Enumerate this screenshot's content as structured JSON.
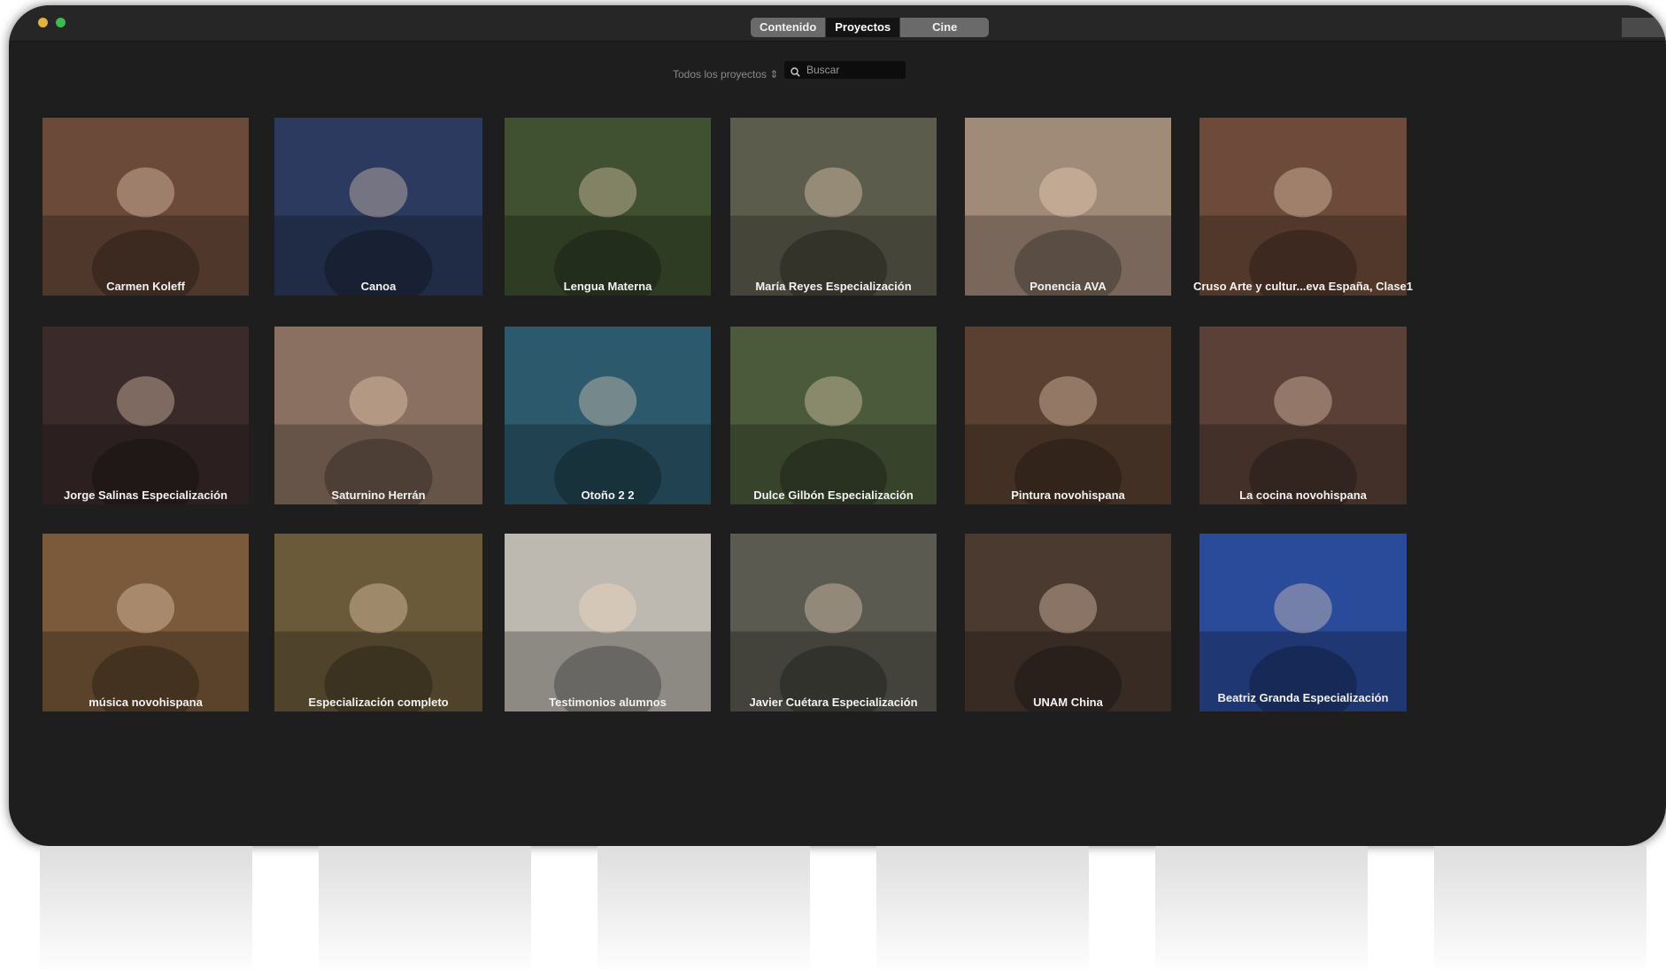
{
  "tabs": [
    {
      "label": "Contenido",
      "active": false
    },
    {
      "label": "Proyectos",
      "active": true
    },
    {
      "label": "Cine",
      "active": false
    }
  ],
  "toolbar": {
    "project_filter": "Todos los proyectos",
    "search_placeholder": "Buscar"
  },
  "projects": [
    {
      "title": "Carmen Koleff",
      "color": "#6b4a3a"
    },
    {
      "title": "Canoa",
      "color": "#2b3a5e"
    },
    {
      "title": "Lengua Materna",
      "color": "#3f5130"
    },
    {
      "title": "María Reyes Especialización",
      "color": "#5c5c4c"
    },
    {
      "title": "Ponencia AVA",
      "color": "#a08a78"
    },
    {
      "title": "Cruso Arte y cultur...eva España, Clase1",
      "color": "#6e4a3a"
    },
    {
      "title": "Jorge Salinas Especialización",
      "color": "#3a2a2a"
    },
    {
      "title": "Saturnino Herrán",
      "color": "#8a7060"
    },
    {
      "title": "Otoño 2 2",
      "color": "#2c5a6c"
    },
    {
      "title": "Dulce Gilbón Especialización",
      "color": "#4a5a3a"
    },
    {
      "title": "Pintura novohispana",
      "color": "#5a4030"
    },
    {
      "title": "La cocina novohispana",
      "color": "#5a4036"
    },
    {
      "title": "música novohispana",
      "color": "#7a5a3a"
    },
    {
      "title": "Especialización completo",
      "color": "#6a5a3a"
    },
    {
      "title": "Testimonios alumnos",
      "color": "#bdb8b0"
    },
    {
      "title": "Javier Cuétara Especialización",
      "color": "#5a5a50"
    },
    {
      "title": "UNAM China",
      "color": "#4a3a30"
    },
    {
      "title": "Beatriz Granda Especialización",
      "color": "#2a4a9a"
    }
  ],
  "ui_colors": {
    "window_bg": "#1e1e1e",
    "titlebar_bg": "#262626",
    "search_bg": "#0d0d0d"
  }
}
